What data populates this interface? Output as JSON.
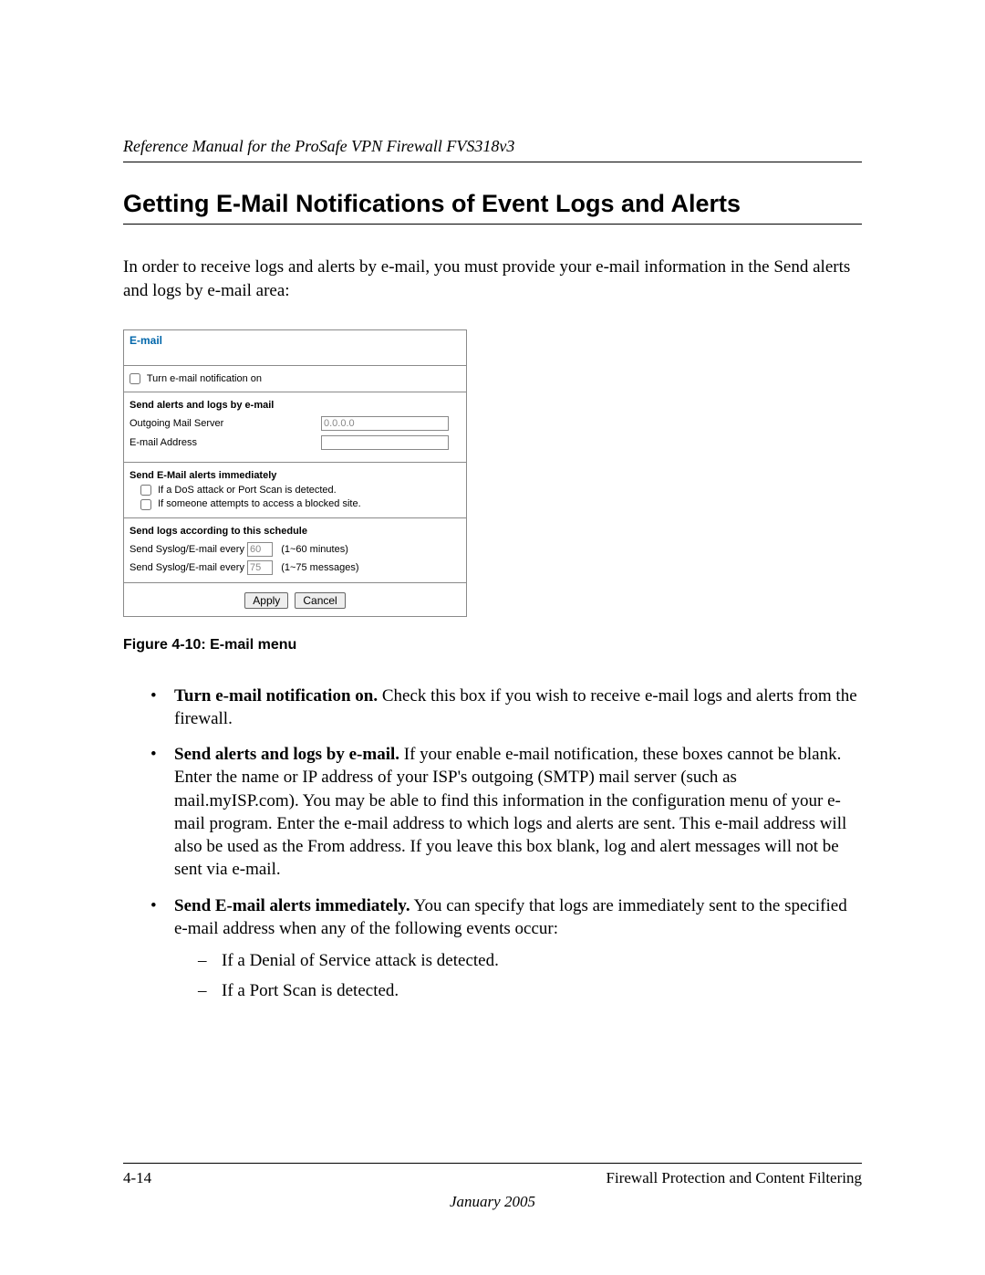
{
  "header": {
    "running": "Reference Manual for the ProSafe VPN Firewall FVS318v3"
  },
  "title": "Getting E-Mail Notifications of Event Logs and Alerts",
  "intro": "In order to receive logs and alerts by e-mail, you must provide your e-mail information in the Send alerts and logs by e-mail area:",
  "panel": {
    "title": "E-mail",
    "turn_on_label": "Turn e-mail notification on",
    "section_send": {
      "heading": "Send alerts and logs by e-mail",
      "mail_server_label": "Outgoing Mail Server",
      "mail_server_value": "0.0.0.0",
      "email_label": "E-mail Address",
      "email_value": ""
    },
    "section_immediate": {
      "heading": "Send E-Mail alerts immediately",
      "opt1": "If a DoS attack or Port Scan is detected.",
      "opt2": "If someone attempts to access a blocked site."
    },
    "section_schedule": {
      "heading": "Send logs according to this schedule",
      "row1_prefix": "Send Syslog/E-mail every",
      "row1_value": "60",
      "row1_suffix": "(1~60 minutes)",
      "row2_prefix": "Send Syslog/E-mail every",
      "row2_value": "75",
      "row2_suffix": "(1~75 messages)"
    },
    "buttons": {
      "apply": "Apply",
      "cancel": "Cancel"
    }
  },
  "figure_caption": "Figure 4-10:  E-mail menu",
  "bullets": {
    "b1_bold": "Turn e-mail notification on.",
    "b1_rest": " Check this box if you wish to receive e-mail logs and alerts from the firewall.",
    "b2_bold": "Send alerts and logs by e-mail.",
    "b2_rest": " If your enable e-mail notification, these boxes cannot be blank. Enter the name or IP address of your ISP's outgoing (SMTP) mail server (such as mail.myISP.com). You may be able to find this information in the configuration menu of your e-mail program. Enter the e-mail address to which logs and alerts are sent. This e-mail address will also be used as the From address. If you leave this box blank, log and alert messages will not be sent via e-mail.",
    "b3_bold": "Send E-mail alerts immediately.",
    "b3_rest": " You can specify that logs are immediately sent to the specified e-mail address when any of the following events occur:",
    "b3_sub1": "If a Denial of Service attack is detected.",
    "b3_sub2": "If a Port Scan is detected."
  },
  "footer": {
    "page": "4-14",
    "chapter": "Firewall Protection and Content Filtering",
    "date": "January 2005"
  }
}
